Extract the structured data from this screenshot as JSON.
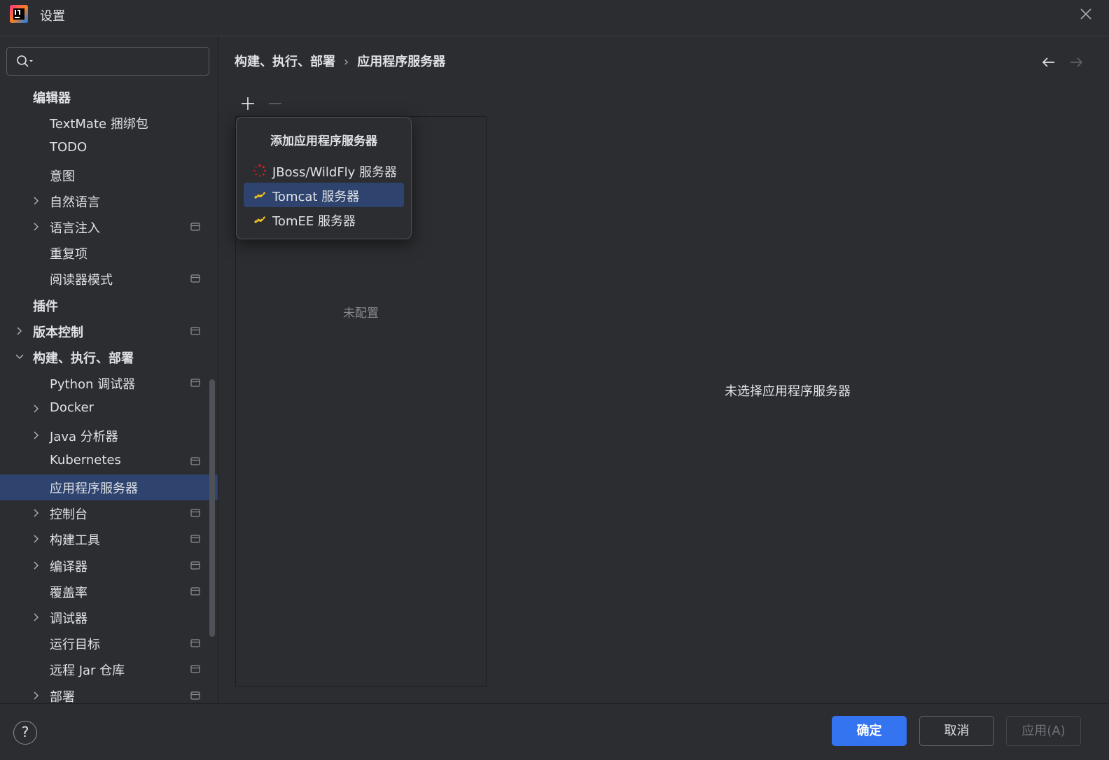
{
  "window": {
    "title": "设置",
    "logo_icon": "intellij-idea-logo-icon",
    "close_icon": "close-icon"
  },
  "search": {
    "value": "",
    "placeholder": ""
  },
  "sidebar": {
    "items": [
      {
        "label": "编辑器",
        "level": 0,
        "bold": true
      },
      {
        "label": "TextMate 捆绑包",
        "level": 1
      },
      {
        "label": "TODO",
        "level": 1
      },
      {
        "label": "意图",
        "level": 1
      },
      {
        "label": "自然语言",
        "level": 1,
        "expandable": true
      },
      {
        "label": "语言注入",
        "level": 1,
        "expandable": true,
        "setting_icon": true
      },
      {
        "label": "重复项",
        "level": 1
      },
      {
        "label": "阅读器模式",
        "level": 1,
        "setting_icon": true
      },
      {
        "label": "插件",
        "level": 0,
        "bold": true
      },
      {
        "label": "版本控制",
        "level": 0,
        "bold": true,
        "expandable": true,
        "setting_icon": true
      },
      {
        "label": "构建、执行、部署",
        "level": 0,
        "bold": true,
        "expanded": true
      },
      {
        "label": "Python 调试器",
        "level": 1,
        "setting_icon": true
      },
      {
        "label": "Docker",
        "level": 1,
        "expandable": true
      },
      {
        "label": "Java 分析器",
        "level": 1,
        "expandable": true
      },
      {
        "label": "Kubernetes",
        "level": 1,
        "setting_icon": true
      },
      {
        "label": "应用程序服务器",
        "level": 1,
        "selected": true
      },
      {
        "label": "控制台",
        "level": 1,
        "expandable": true,
        "setting_icon": true
      },
      {
        "label": "构建工具",
        "level": 1,
        "expandable": true,
        "setting_icon": true
      },
      {
        "label": "编译器",
        "level": 1,
        "expandable": true,
        "setting_icon": true
      },
      {
        "label": "覆盖率",
        "level": 1,
        "setting_icon": true
      },
      {
        "label": "调试器",
        "level": 1,
        "expandable": true
      },
      {
        "label": "运行目标",
        "level": 1,
        "setting_icon": true
      },
      {
        "label": "远程 Jar 仓库",
        "level": 1,
        "setting_icon": true
      },
      {
        "label": "部署",
        "level": 1,
        "expandable": true,
        "setting_icon": true
      }
    ]
  },
  "breadcrumb": {
    "parent": "构建、执行、部署",
    "separator": "›",
    "current": "应用程序服务器"
  },
  "main": {
    "empty_list_text": "未配置",
    "no_selection_text": "未选择应用程序服务器"
  },
  "popup": {
    "title": "添加应用程序服务器",
    "items": [
      {
        "label": "JBoss/WildFly 服务器",
        "icon": "jboss-wildfly-icon"
      },
      {
        "label": "Tomcat 服务器",
        "icon": "tomcat-icon",
        "selected": true
      },
      {
        "label": "TomEE 服务器",
        "icon": "tomee-icon"
      }
    ]
  },
  "footer": {
    "help_label": "?",
    "ok_label": "确定",
    "cancel_label": "取消",
    "apply_label": "应用(A)"
  },
  "colors": {
    "background": "#2b2d30",
    "selection": "#2e436e",
    "primary_button": "#3574f0",
    "text": "#dfe1e5",
    "muted_text": "#868a91"
  }
}
